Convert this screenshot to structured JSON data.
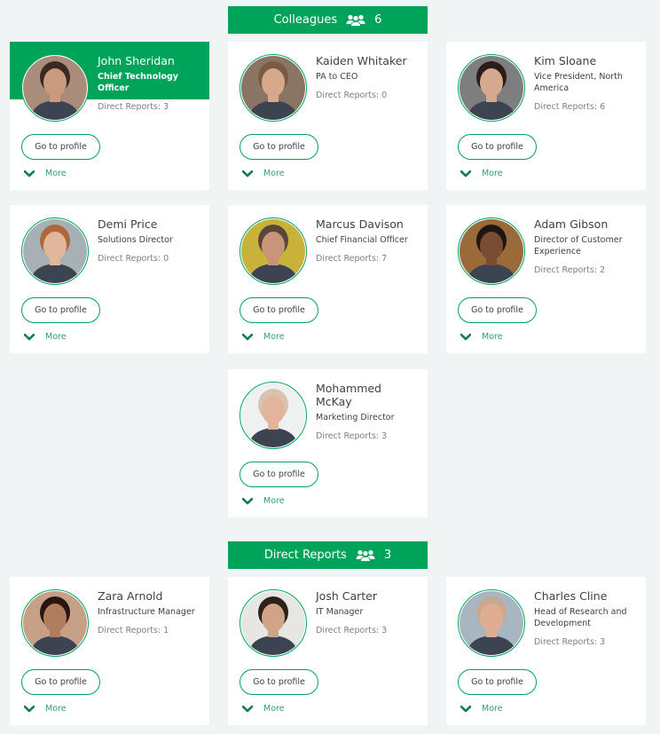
{
  "colleagues_header": {
    "label": "Colleagues",
    "icon": "people-group-icon",
    "count": "6"
  },
  "direct_reports_header": {
    "label": "Direct Reports",
    "icon": "people-group-icon",
    "count": "3"
  },
  "colors": {
    "accent": "#00a35a",
    "background": "#f0f4f5",
    "card": "#ffffff",
    "more_text": "#2f9e72"
  },
  "profile_button_label": "Go to profile",
  "more_label": "More",
  "cards": [
    {
      "name": "John Sheridan",
      "title": "Chief Technology Officer",
      "reports": "Direct Reports: 3",
      "highlight": true,
      "avatar": {
        "bg": "#a98c7a",
        "skin": "#c99a7e",
        "hair": "#3a2a22"
      }
    },
    {
      "name": "Kaiden Whitaker",
      "title": "PA to CEO",
      "reports": "Direct Reports: 0",
      "avatar": {
        "bg": "#8a7564",
        "skin": "#d7a88c",
        "hair": "#7b5a44"
      }
    },
    {
      "name": "Kim Sloane",
      "title": "Vice President, North America",
      "reports": "Direct Reports: 6",
      "avatar": {
        "bg": "#7e7e80",
        "skin": "#d6a88f",
        "hair": "#2a1d18"
      }
    },
    {
      "name": "Demi Price",
      "title": "Solutions Director",
      "reports": "Direct Reports: 0",
      "avatar": {
        "bg": "#a6b0b5",
        "skin": "#e1b69a",
        "hair": "#b0683a"
      }
    },
    {
      "name": "Marcus Davison",
      "title": "Chief Financial Officer",
      "reports": "Direct Reports: 7",
      "avatar": {
        "bg": "#c8b23a",
        "skin": "#c8957a",
        "hair": "#5a4638"
      }
    },
    {
      "name": "Adam Gibson",
      "title": "Director of Customer Experience",
      "reports": "Direct Reports: 2",
      "avatar": {
        "bg": "#9a6a3a",
        "skin": "#7a4d33",
        "hair": "#1e1612"
      }
    },
    {
      "name": "Mohammed McKay",
      "title": "Marketing Director",
      "reports": "Direct Reports: 3",
      "avatar": {
        "bg": "#eef0f2",
        "skin": "#e4b49a",
        "hair": "#d9c2b0"
      }
    },
    {
      "name": "Zara Arnold",
      "title": "Infrastructure Manager",
      "reports": "Direct Reports: 1",
      "avatar": {
        "bg": "#c6a188",
        "skin": "#b07d5e",
        "hair": "#2a1610"
      }
    },
    {
      "name": "Josh Carter",
      "title": "IT Manager",
      "reports": "Direct Reports: 3",
      "avatar": {
        "bg": "#e6e6e2",
        "skin": "#d1a487",
        "hair": "#2e2119"
      }
    },
    {
      "name": "Charles Cline",
      "title": "Head of Research and Development",
      "reports": "Direct Reports: 3",
      "avatar": {
        "bg": "#a7b6c0",
        "skin": "#dfae92",
        "hair": "#c9a892"
      }
    }
  ]
}
